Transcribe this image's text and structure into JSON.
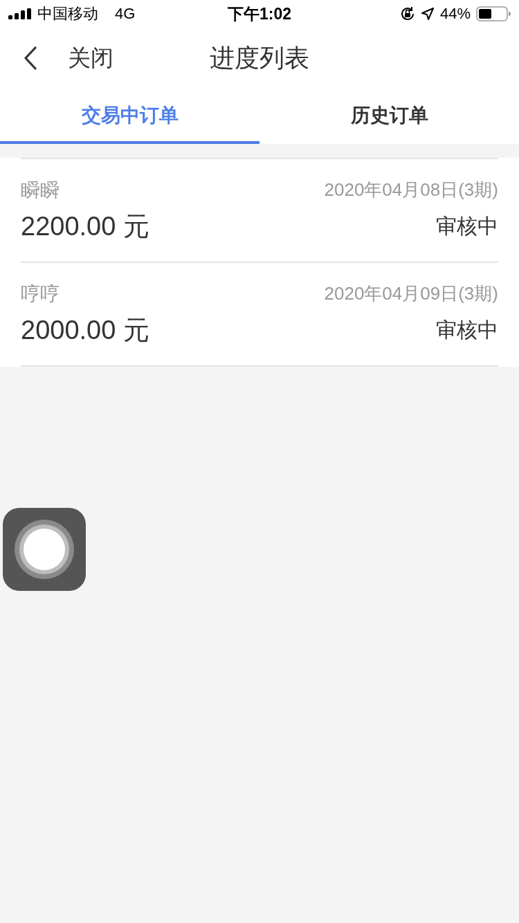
{
  "status_bar": {
    "carrier": "中国移动",
    "network": "4G",
    "time": "下午1:02",
    "battery": "44%"
  },
  "nav": {
    "back_label": "关闭",
    "title": "进度列表"
  },
  "tabs": [
    {
      "label": "交易中订单",
      "selected": true
    },
    {
      "label": "历史订单",
      "selected": false
    }
  ],
  "orders": [
    {
      "name": "瞬瞬",
      "date": "2020年04月08日(3期)",
      "amount": "2200.00 元",
      "status": "审核中"
    },
    {
      "name": "哼哼",
      "date": "2020年04月09日(3期)",
      "amount": "2000.00 元",
      "status": "审核中"
    }
  ]
}
